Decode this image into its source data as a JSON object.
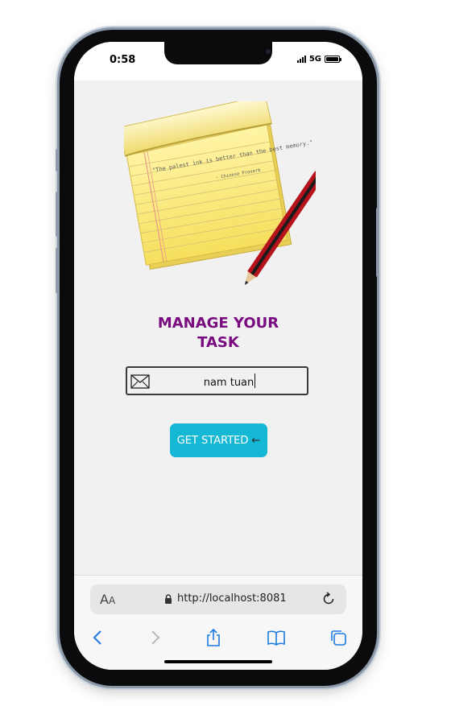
{
  "status_bar": {
    "time": "0:58",
    "network": "5G"
  },
  "app": {
    "title_line1": "MANAGE YOUR",
    "title_line2": "TASK",
    "illustration": "notepad-with-pencil",
    "notepad_quote": "\"The palest ink is better than the best memory.\"",
    "notepad_attribution": "- Chinese Proverb",
    "name_input": {
      "value": "nam tuan",
      "icon": "envelope-icon"
    },
    "start_button": {
      "label": "GET STARTED",
      "icon": "arrow-left-icon"
    },
    "colors": {
      "title": "#7a0a80",
      "button": "#14b8d4",
      "background": "#f1f1f1"
    }
  },
  "browser": {
    "text_size_label_large": "A",
    "text_size_label_small": "A",
    "url": "http://localhost:8081",
    "icons": [
      "back-icon",
      "forward-icon",
      "share-icon",
      "bookmarks-icon",
      "tabs-icon",
      "reload-icon",
      "lock-icon"
    ]
  }
}
